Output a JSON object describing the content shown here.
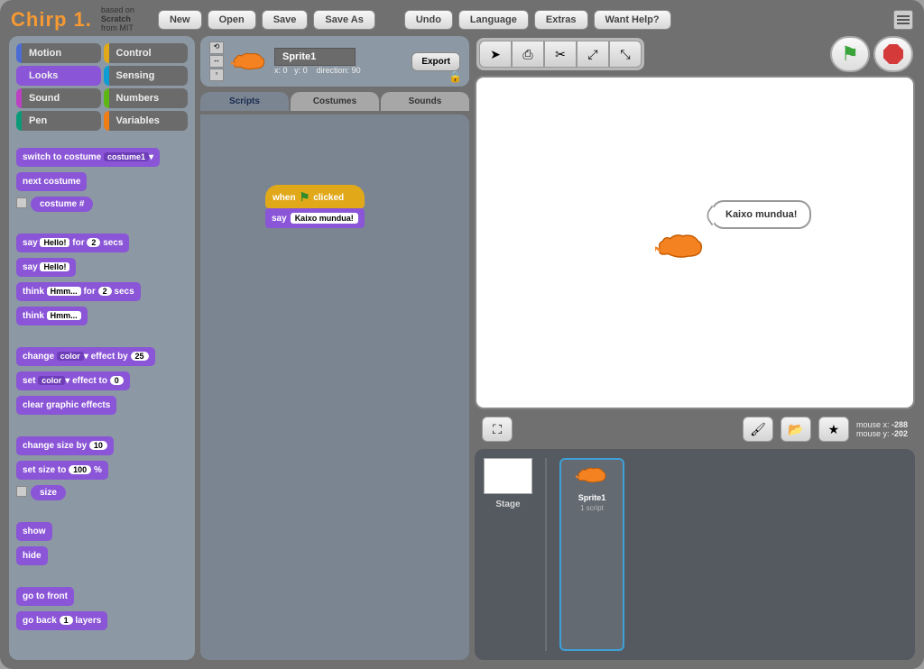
{
  "app": {
    "name": "Chirp 1.",
    "tagline1": "based on",
    "tagline2": "Scratch",
    "tagline3": "from MIT"
  },
  "toolbar": {
    "new": "New",
    "open": "Open",
    "save": "Save",
    "save_as": "Save As",
    "undo": "Undo",
    "language": "Language",
    "extras": "Extras",
    "help": "Want Help?"
  },
  "categories": {
    "motion": "Motion",
    "control": "Control",
    "looks": "Looks",
    "sensing": "Sensing",
    "sound": "Sound",
    "numbers": "Numbers",
    "pen": "Pen",
    "variables": "Variables"
  },
  "blocks": {
    "switch_costume": "switch to costume",
    "costume_opt": "costume1",
    "next_costume": "next costume",
    "costume_num": "costume #",
    "say_for": "say",
    "hello": "Hello!",
    "for": "for",
    "secs": "secs",
    "n2": "2",
    "say": "say",
    "think_for": "think",
    "hmm": "Hmm...",
    "think": "think",
    "change_effect": "change",
    "color": "color",
    "effect_by": "effect by",
    "n25": "25",
    "set_effect": "set",
    "effect_to": "effect to",
    "n0": "0",
    "clear_effects": "clear graphic effects",
    "change_size": "change size by",
    "n10": "10",
    "set_size": "set size to",
    "n100": "100",
    "pct": "%",
    "size": "size",
    "show": "show",
    "hide": "hide",
    "goto_front": "go to front",
    "go_back": "go back",
    "n1": "1",
    "layers": "layers"
  },
  "sprite_info": {
    "name": "Sprite1",
    "x_lbl": "x:",
    "x": "0",
    "y_lbl": "y:",
    "y": "0",
    "dir_lbl": "direction:",
    "dir": "90",
    "export": "Export"
  },
  "tabs": {
    "scripts": "Scripts",
    "costumes": "Costumes",
    "sounds": "Sounds"
  },
  "script": {
    "when": "when",
    "clicked": "clicked",
    "say": "say",
    "msg": "Kaixo mundua!"
  },
  "stage": {
    "speech": "Kaixo mundua!"
  },
  "mouse": {
    "x_lbl": "mouse x:",
    "x": "-288",
    "y_lbl": "mouse y:",
    "y": "-202"
  },
  "sprites": {
    "stage_lbl": "Stage",
    "card": {
      "name": "Sprite1",
      "scripts": "1 script"
    }
  }
}
